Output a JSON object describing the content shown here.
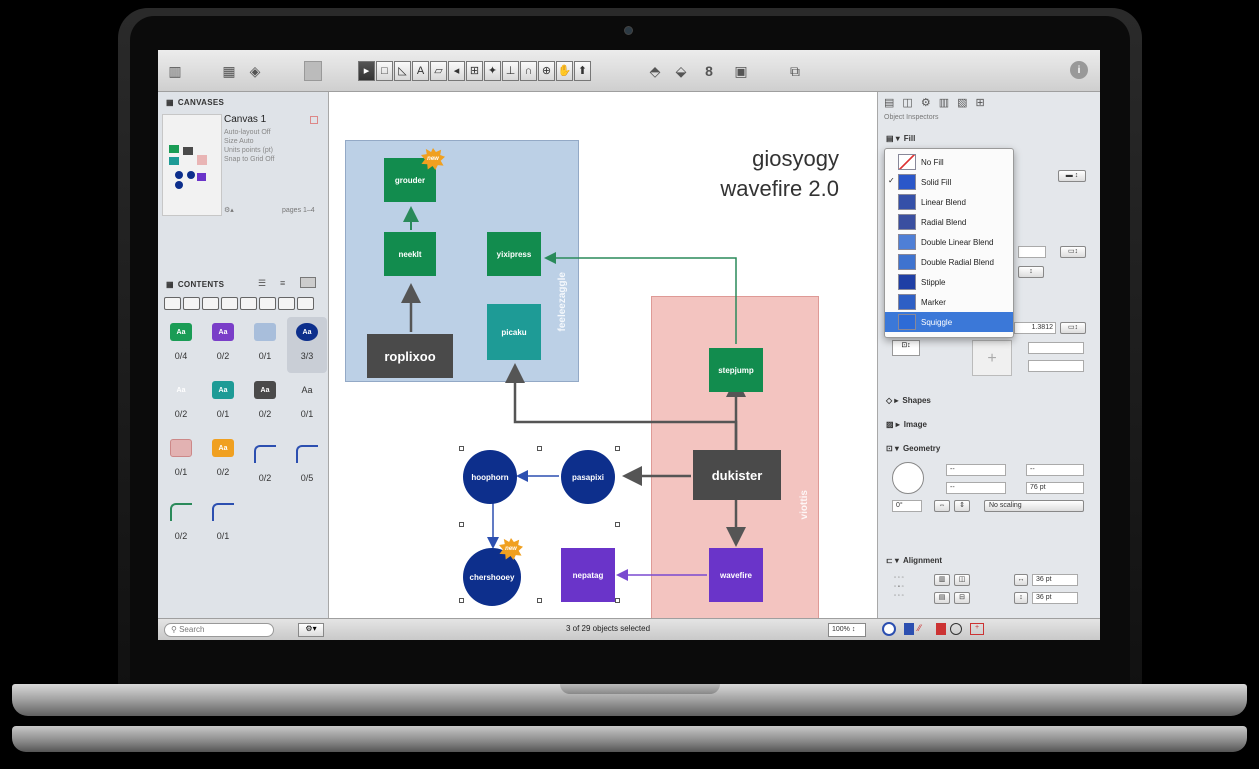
{
  "toolbar": {
    "tools": [
      "▸",
      "□",
      "◺",
      "A",
      "▱",
      "◂",
      "⊞",
      "✦",
      "⊥",
      "∩",
      "⊕",
      "✋",
      "⬆"
    ],
    "info_icon": "i"
  },
  "canvases": {
    "header": "CANVASES",
    "name": "Canvas 1",
    "meta": [
      "Auto-layout Off",
      "Size Auto",
      "Units points (pt)",
      "Snap to Grid Off"
    ],
    "pages": "pages 1–4"
  },
  "contents": {
    "header": "CONTENTS",
    "styles": [
      {
        "label": "Aa",
        "color": "#1a9c55",
        "count": "0/4"
      },
      {
        "label": "Aa",
        "color": "#7a3ec8",
        "count": "0/2"
      },
      {
        "label": "",
        "color": "#a8bedb",
        "count": "0/1"
      },
      {
        "label": "Aa",
        "color": "#0d2f8c",
        "count": "3/3",
        "selected": true
      },
      {
        "label": "Aa",
        "color": "#dfe3e8",
        "count": "0/2"
      },
      {
        "label": "Aa",
        "color": "#1e9b96",
        "count": "0/1"
      },
      {
        "label": "Aa",
        "color": "#4a4a4a",
        "count": "0/2"
      },
      {
        "label": "Aa",
        "color": "transparent",
        "count": "0/1"
      },
      {
        "label": "",
        "color": "#e2b2b2",
        "count": "0/1"
      },
      {
        "label": "Aa",
        "color": "#f0a020",
        "count": "0/2"
      },
      {
        "label": "",
        "color": "line",
        "count": "0/2"
      },
      {
        "label": "",
        "color": "line",
        "count": "0/5"
      },
      {
        "label": "",
        "color": "line-green",
        "count": "0/2"
      },
      {
        "label": "",
        "color": "line",
        "count": "0/1"
      }
    ]
  },
  "canvas": {
    "title_line1": "giosyogy",
    "title_line2": "wavefire 2.0",
    "group_blue_label": "feeleezaggle",
    "group_pink_label": "viottis",
    "nodes": {
      "grouder": "grouder",
      "neeklt": "neeklt",
      "yixipress": "yixipress",
      "roplixoo": "roplixoo",
      "picaku": "picaku",
      "stepjump": "stepjump",
      "dukister": "dukister",
      "hoophorn": "hoophorn",
      "pasapixi": "pasapixi",
      "chershooey": "chershooey",
      "nepatag": "nepatag",
      "wavefire": "wavefire"
    },
    "badge": "new"
  },
  "inspector": {
    "subtitle": "Object Inspectors",
    "fill_section": "Fill",
    "fill_options": [
      {
        "label": "No Fill",
        "swatch": "none"
      },
      {
        "label": "Solid Fill",
        "swatch": "#2b57c9",
        "checked": true
      },
      {
        "label": "Linear Blend",
        "swatch": "#3550a8"
      },
      {
        "label": "Radial Blend",
        "swatch": "#3a4fa0"
      },
      {
        "label": "Double Linear Blend",
        "swatch": "#4f7fd6"
      },
      {
        "label": "Double Radial Blend",
        "swatch": "#3f73cf"
      },
      {
        "label": "Stipple",
        "swatch": "#1f3fa5"
      },
      {
        "label": "Marker",
        "swatch": "#2e5fc5"
      },
      {
        "label": "Squiggle",
        "swatch": "#2e6bd6",
        "highlighted": true
      }
    ],
    "shapes_section": "Shapes",
    "image_section": "Image",
    "geometry_section": "Geometry",
    "geometry": {
      "width": "--",
      "x": "--",
      "height": "--",
      "y": "76 pt",
      "rotation": "0°",
      "scaling": "No scaling"
    },
    "stroke_value": "1.3812",
    "alignment_section": "Alignment",
    "alignment": {
      "h_spacing": "36 pt",
      "v_spacing": "36 pt"
    }
  },
  "status": {
    "search_placeholder": "Search",
    "selection_text": "3 of 29 objects selected",
    "zoom": "100%"
  }
}
